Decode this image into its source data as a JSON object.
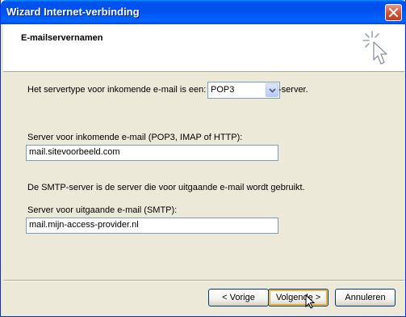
{
  "window": {
    "title": "Wizard Internet-verbinding"
  },
  "header": {
    "heading": "E-mailservernamen",
    "icon": "wizard-sparkle-cursor-icon"
  },
  "incoming_type": {
    "label_before": "Het servertype voor inkomende e-mail is een:",
    "selected": "POP3",
    "label_after": "-server."
  },
  "incoming_server": {
    "label": "Server voor inkomende e-mail (POP3, IMAP of HTTP):",
    "value": "mail.sitevoorbeeld.com"
  },
  "smtp_info": "De SMTP-server is de server die voor uitgaande e-mail wordt gebruikt.",
  "outgoing_server": {
    "label": "Server voor uitgaande e-mail (SMTP):",
    "value": "mail.mijn-access-provider.nl"
  },
  "buttons": {
    "back": "< Vorige",
    "next": "Volgende >",
    "cancel": "Annuleren"
  },
  "colors": {
    "titlebar": "#0053ee",
    "face": "#ece9d8",
    "close": "#d85a3c"
  }
}
